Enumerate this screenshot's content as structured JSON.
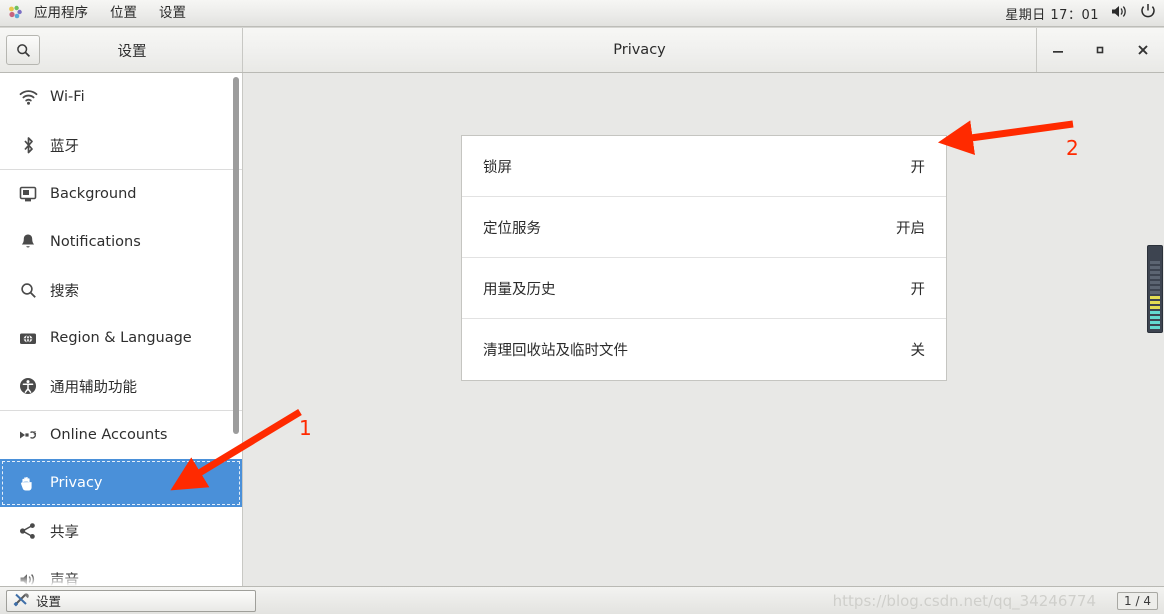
{
  "top_panel": {
    "logo_icon": "gnome-foot-icon",
    "menus": [
      {
        "label": "应用程序",
        "name": "menu-applications"
      },
      {
        "label": "位置",
        "name": "menu-places"
      },
      {
        "label": "设置",
        "name": "menu-settings"
      }
    ],
    "clock": "星期日 17：01",
    "volume_icon": "volume-icon",
    "power_icon": "power-icon"
  },
  "titlebar": {
    "search_icon": "search-icon",
    "sidebar_title": "设置",
    "window_title": "Privacy",
    "minimize_label": "minimize",
    "maximize_label": "maximize",
    "close_label": "close"
  },
  "sidebar": {
    "items": [
      {
        "label": "Wi-Fi",
        "icon": "wifi-icon",
        "name": "sidebar-item-wifi",
        "selected": false
      },
      {
        "label": "蓝牙",
        "icon": "bluetooth-icon",
        "name": "sidebar-item-bluetooth",
        "selected": false
      },
      {
        "label": "Background",
        "icon": "monitor-icon",
        "name": "sidebar-item-background",
        "selected": false
      },
      {
        "label": "Notifications",
        "icon": "bell-icon",
        "name": "sidebar-item-notifications",
        "selected": false
      },
      {
        "label": "搜索",
        "icon": "search-icon",
        "name": "sidebar-item-search",
        "selected": false
      },
      {
        "label": "Region & Language",
        "icon": "globe-icon",
        "name": "sidebar-item-region-language",
        "selected": false
      },
      {
        "label": "通用辅助功能",
        "icon": "accessibility-icon",
        "name": "sidebar-item-universal-access",
        "selected": false
      },
      {
        "label": "Online Accounts",
        "icon": "online-accounts-icon",
        "name": "sidebar-item-online-accounts",
        "selected": false
      },
      {
        "label": "Privacy",
        "icon": "hand-icon",
        "name": "sidebar-item-privacy",
        "selected": true
      },
      {
        "label": "共享",
        "icon": "share-icon",
        "name": "sidebar-item-sharing",
        "selected": false
      },
      {
        "label": "声音",
        "icon": "speaker-icon",
        "name": "sidebar-item-sound",
        "selected": false
      }
    ],
    "separator_after_indexes": [
      1,
      6
    ]
  },
  "privacy_panel": {
    "rows": [
      {
        "label": "锁屏",
        "value": "开",
        "name": "privacy-row-lock-screen"
      },
      {
        "label": "定位服务",
        "value": "开启",
        "name": "privacy-row-location-services"
      },
      {
        "label": "用量及历史",
        "value": "开",
        "name": "privacy-row-usage-history"
      },
      {
        "label": "清理回收站及临时文件",
        "value": "关",
        "name": "privacy-row-purge-trash-temp"
      }
    ]
  },
  "annotations": {
    "arrow_one_label": "1",
    "arrow_two_label": "2",
    "arrow_color": "#ff2a00"
  },
  "taskbar": {
    "window_button_label": "设置",
    "window_button_icon": "tools-icon",
    "workspace_indicator": "1 / 4"
  },
  "watermark": {
    "text": "https://blog.csdn.net/qq_34246774"
  },
  "colors": {
    "selection_blue": "#4a90d9",
    "panel_bg": "#e8e8e6",
    "card_bg": "#ffffff",
    "accent_red": "#ff2a00"
  }
}
